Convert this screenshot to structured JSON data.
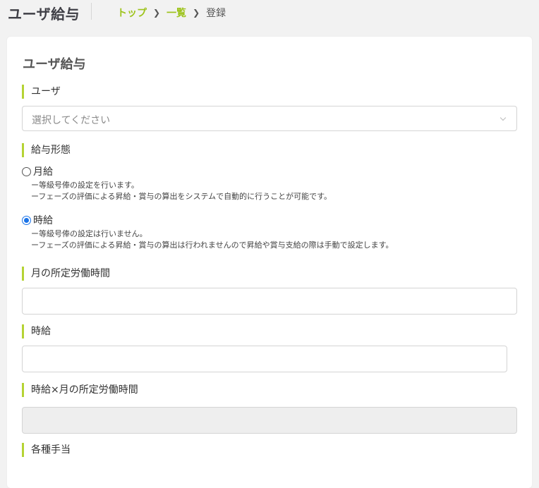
{
  "header": {
    "title": "ユーザ給与",
    "breadcrumb": [
      {
        "label": "トップ"
      },
      {
        "label": "一覧"
      },
      {
        "label": "登録"
      }
    ]
  },
  "form": {
    "title": "ユーザ給与",
    "user": {
      "label": "ユーザ",
      "placeholder": "選択してください"
    },
    "pay_type": {
      "label": "給与形態",
      "options": [
        {
          "label": "月給",
          "selected": false,
          "notes": [
            "ー等級号俸の設定を行います。",
            "ーフェーズの評価による昇給・賞与の算出をシステムで自動的に行うことが可能です。"
          ]
        },
        {
          "label": "時給",
          "selected": true,
          "notes": [
            "ー等級号俸の設定は行いません。",
            "ーフェーズの評価による昇給・賞与の算出は行われませんので昇給や賞与支給の際は手動で設定します。"
          ]
        }
      ]
    },
    "monthly_hours": {
      "label": "月の所定労働時間",
      "value": ""
    },
    "hourly_wage": {
      "label": "時給",
      "value": ""
    },
    "hourly_x_hours": {
      "label": "時給×月の所定労働時間",
      "value": ""
    },
    "allowances": {
      "label": "各種手当"
    }
  },
  "colors": {
    "accent": "#b5d334",
    "breadcrumb_link": "#9dc31b",
    "radio_selected": "#1a73e8",
    "disabled_field": "#eeeeee"
  }
}
